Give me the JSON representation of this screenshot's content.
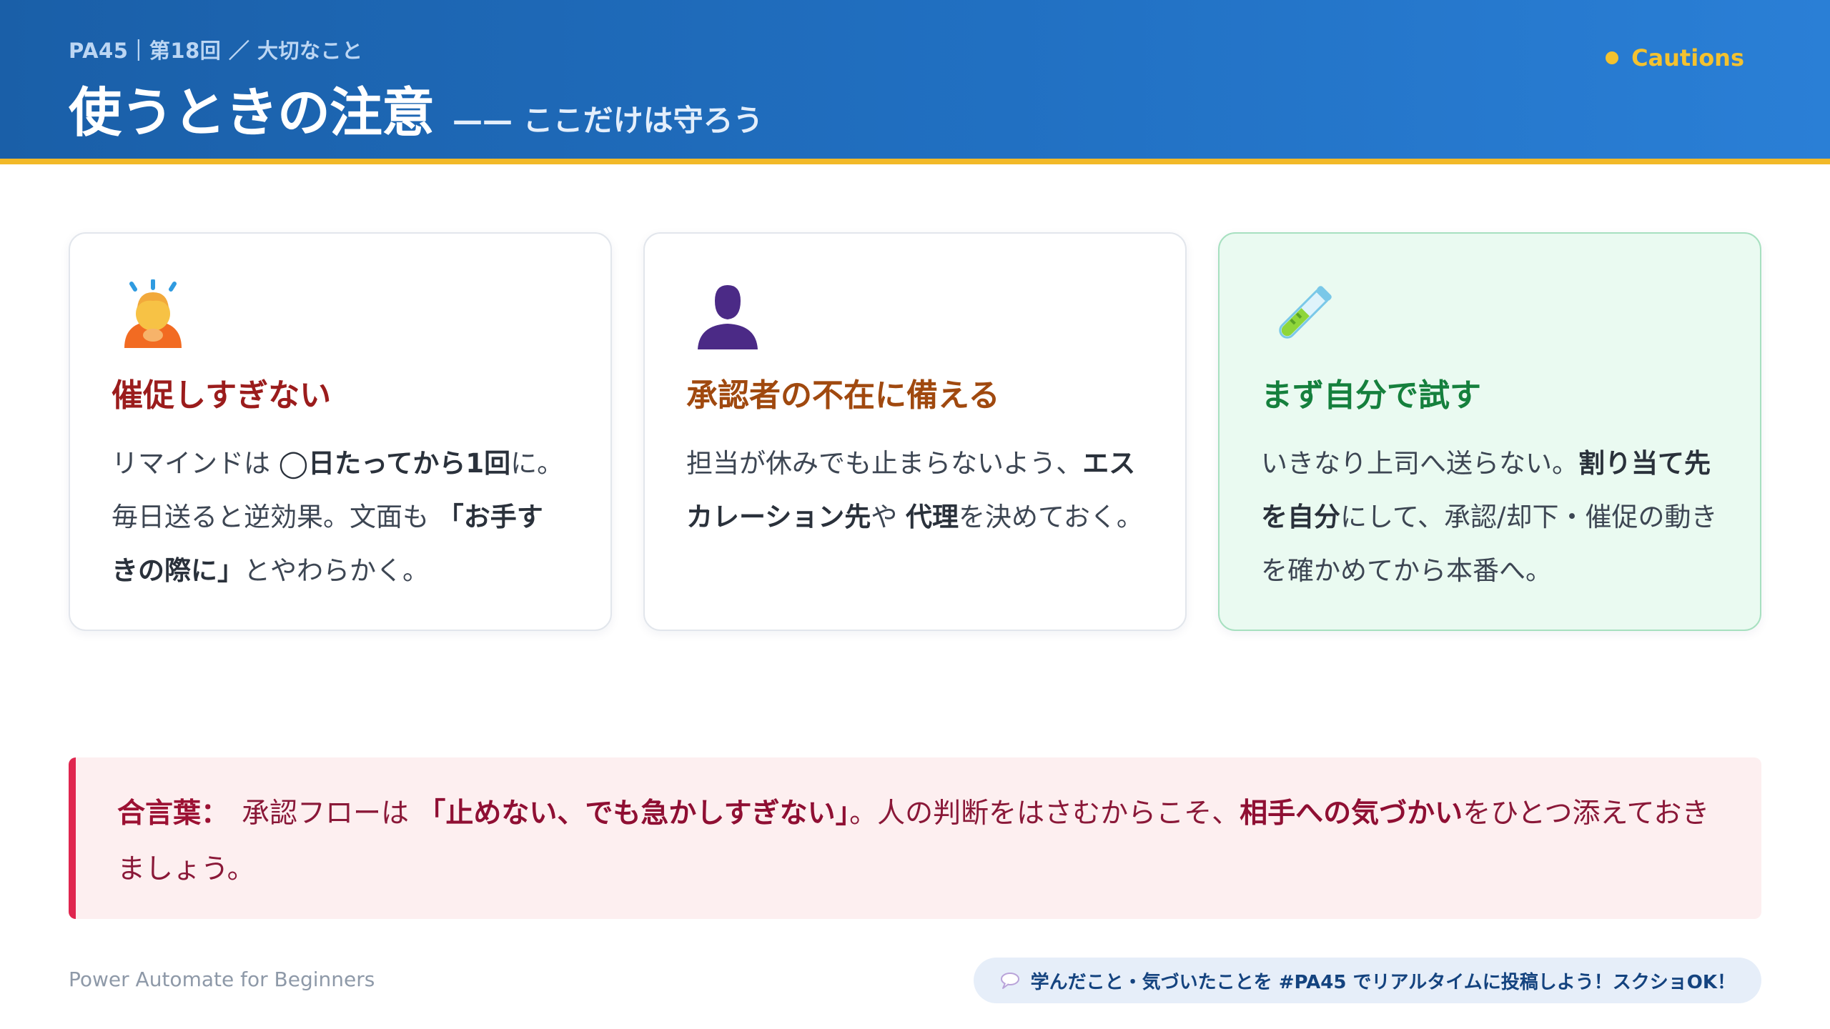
{
  "header": {
    "eyebrow": "PA45｜第18回 ／ 大切なこと",
    "title": "使うときの注意",
    "subtitle": "—— ここだけは守ろう",
    "tag": "Cautions"
  },
  "cards": [
    {
      "icon": "bowing-person-icon",
      "title": "催促しすぎない",
      "title_color": "#9b1c1c",
      "body": [
        {
          "text": "リマインドは ",
          "bold": false
        },
        {
          "text": "◯日たってから1回",
          "bold": true
        },
        {
          "text": "に。毎日送ると逆効果。文面も ",
          "bold": false
        },
        {
          "text": "「お手すきの際に」",
          "bold": true
        },
        {
          "text": "とやわらかく。",
          "bold": false
        }
      ]
    },
    {
      "icon": "person-silhouette-icon",
      "title": "承認者の不在に備える",
      "title_color": "#a0490f",
      "body": [
        {
          "text": "担当が休みでも止まらないよう、",
          "bold": false
        },
        {
          "text": "エスカレーション先",
          "bold": true
        },
        {
          "text": "や ",
          "bold": false
        },
        {
          "text": "代理",
          "bold": true
        },
        {
          "text": "を決めておく。",
          "bold": false
        }
      ]
    },
    {
      "icon": "test-tube-icon",
      "title": "まず自分で試す",
      "title_color": "#15803d",
      "body": [
        {
          "text": "いきなり上司へ送らない。",
          "bold": false
        },
        {
          "text": "割り当て先を自分",
          "bold": true
        },
        {
          "text": "にして、承認/却下・催促の動きを確かめてから本番へ。",
          "bold": false
        }
      ]
    }
  ],
  "motto": {
    "label": "合言葉：",
    "body": [
      {
        "text": "承認フローは ",
        "bold": false
      },
      {
        "text": "「止めない、でも急かしすぎない」",
        "bold": true
      },
      {
        "text": "。人の判断をはさむからこそ、",
        "bold": false
      },
      {
        "text": "相手への気づかい",
        "bold": true
      },
      {
        "text": "をひとつ添えておきましょう。",
        "bold": false
      }
    ]
  },
  "footer": {
    "left": "Power Automate for Beginners",
    "pill_icon": "speech-bubble-icon",
    "pill": "学んだこと・気づいたことを #PA45 でリアルタイムに投稿しよう！スクショOK！"
  },
  "colors": {
    "accent_yellow": "#f4c22f",
    "header_blue": "#1a5fa8",
    "motto_red": "#e0264f"
  }
}
